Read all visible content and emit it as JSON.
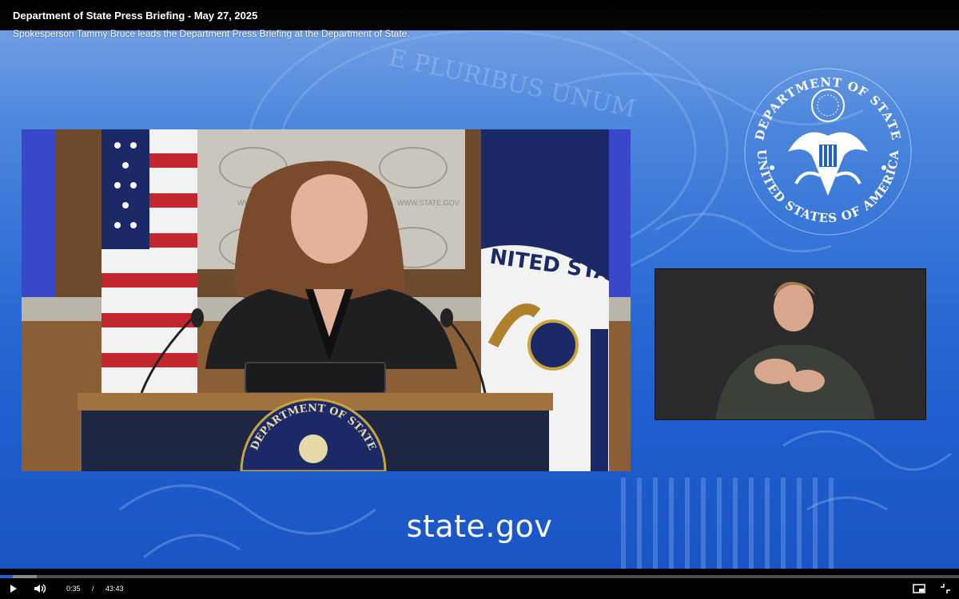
{
  "header": {
    "title": "Department of State Press Briefing - May 27, 2025",
    "description": "Spokesperson Tammy Bruce leads the Department Press Briefing at the Department of State."
  },
  "stage": {
    "site_label": "state.gov",
    "seal_text_top": "DEPARTMENT OF STATE",
    "seal_text_bottom": "UNITED STATES OF AMERICA",
    "watermark_text": "E PLURIBUS UNUM"
  },
  "main_video": {
    "podium_seal_text": "DEPARTMENT OF STATE",
    "backdrop_text": "WWW.STATE.GOV",
    "flag_text": "UNITED STATES OF AMERICA"
  },
  "controls": {
    "current_time": "0:35",
    "separator": "/",
    "duration": "43:43",
    "progress_fraction": 0.0133,
    "buffered_fraction": 0.038
  },
  "colors": {
    "accent": "#2a5bd7",
    "stage_blue": "#1f5fcf"
  },
  "icons": {
    "play": "play-icon",
    "volume": "volume-icon",
    "pip": "picture-in-picture-icon",
    "exit_fullscreen": "exit-fullscreen-icon"
  }
}
